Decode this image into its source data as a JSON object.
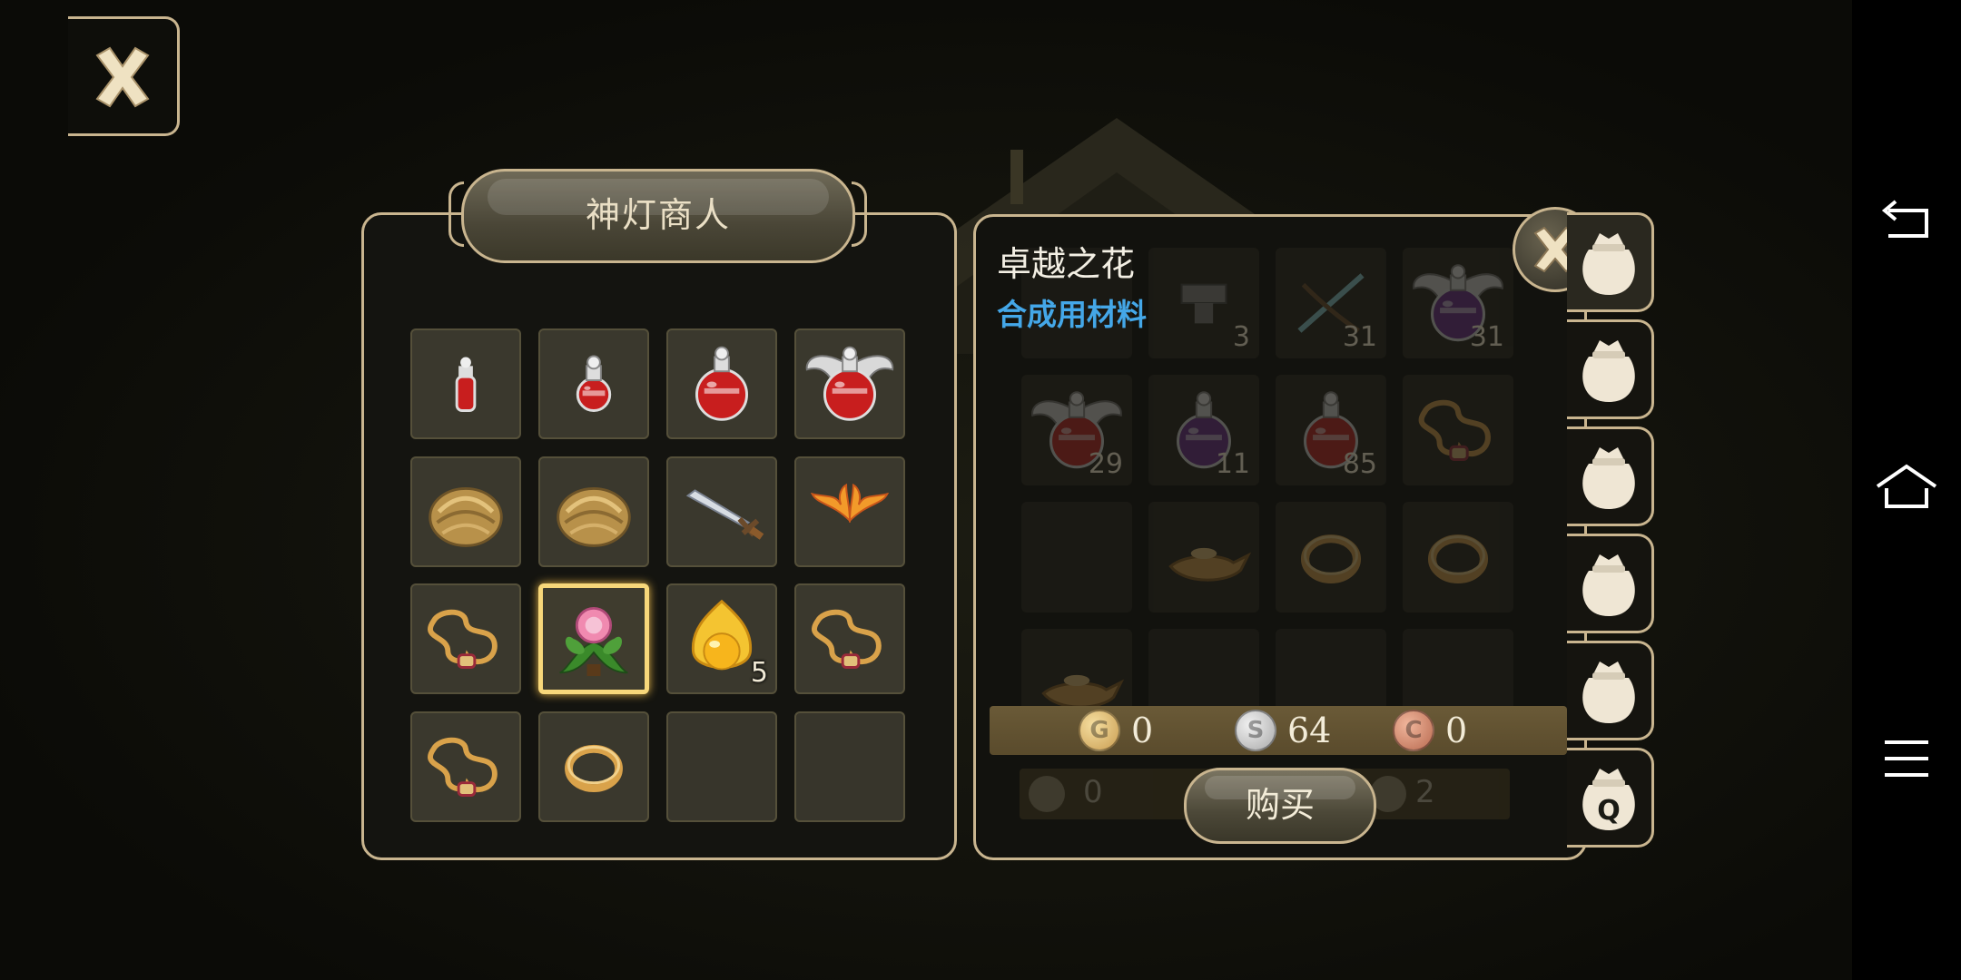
{
  "shop": {
    "title": "神灯商人",
    "items": [
      {
        "icon": "small-red-potion-icon",
        "count": ""
      },
      {
        "icon": "medium-red-potion-icon",
        "count": ""
      },
      {
        "icon": "large-red-potion-icon",
        "count": ""
      },
      {
        "icon": "winged-red-potion-icon",
        "count": ""
      },
      {
        "icon": "gold-ore-icon",
        "count": ""
      },
      {
        "icon": "gold-ore-icon",
        "count": ""
      },
      {
        "icon": "sword-icon",
        "count": ""
      },
      {
        "icon": "fire-wings-icon",
        "count": ""
      },
      {
        "icon": "gold-necklace-icon",
        "count": ""
      },
      {
        "icon": "flower-icon",
        "count": "",
        "selected": true
      },
      {
        "icon": "golden-apple-icon",
        "count": "5"
      },
      {
        "icon": "gold-necklace-icon",
        "count": ""
      },
      {
        "icon": "gold-necklace-icon",
        "count": ""
      },
      {
        "icon": "gold-ring-icon",
        "count": ""
      },
      {
        "icon": "",
        "count": ""
      },
      {
        "icon": "",
        "count": ""
      }
    ]
  },
  "detail": {
    "item_name": "卓越之花",
    "item_type": "合成用材料",
    "price": {
      "gold": "0",
      "silver": "64",
      "copper": "0"
    },
    "buy_label": "购买"
  },
  "inventory": {
    "items": [
      {
        "icon": "",
        "count": ""
      },
      {
        "icon": "anvil-icon",
        "count": "3"
      },
      {
        "icon": "crossbow-icon",
        "count": "31"
      },
      {
        "icon": "winged-purple-potion-icon",
        "count": "31"
      },
      {
        "icon": "winged-red-potion-icon",
        "count": "29"
      },
      {
        "icon": "purple-potion-icon",
        "count": "11"
      },
      {
        "icon": "large-red-potion-icon",
        "count": "85"
      },
      {
        "icon": "gold-necklace-icon",
        "count": ""
      },
      {
        "icon": "",
        "count": ""
      },
      {
        "icon": "magic-lamp-icon",
        "count": ""
      },
      {
        "icon": "gold-ring-icon",
        "count": ""
      },
      {
        "icon": "gold-ring-icon",
        "count": ""
      },
      {
        "icon": "magic-lamp-icon",
        "count": ""
      },
      {
        "icon": "",
        "count": ""
      },
      {
        "icon": "",
        "count": ""
      },
      {
        "icon": "",
        "count": ""
      }
    ],
    "money_ghost": {
      "left": "0",
      "right": "2"
    }
  },
  "bag_tabs": [
    "bag-icon",
    "bag-icon",
    "bag-icon",
    "bag-icon",
    "bag-icon",
    "quest-bag-icon"
  ],
  "colors": {
    "accent_border": "#c9b58f",
    "item_type": "#44a7e8",
    "selected_glow": "#f7d77a"
  }
}
